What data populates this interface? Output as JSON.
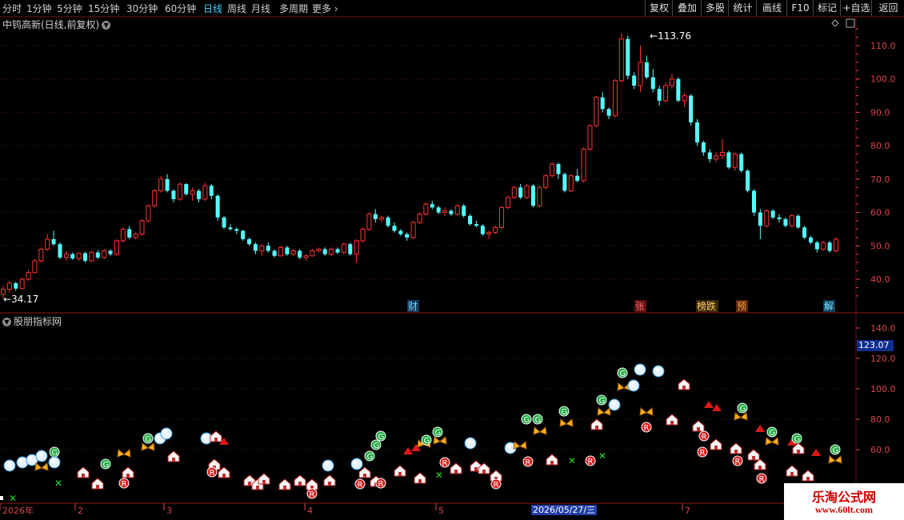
{
  "toolbar": {
    "periods": [
      "分时",
      "1分钟",
      "5分钟",
      "15分钟",
      "30分钟",
      "60分钟",
      "日线",
      "周线",
      "月线",
      "多周期",
      "更多"
    ],
    "active_period": "日线",
    "right_buttons": [
      "复权",
      "叠加",
      "多股",
      "统计",
      "画线",
      "F10",
      "标记",
      "+自选",
      "返回"
    ]
  },
  "main_panel": {
    "title": "中钨高新(日线,前复权)",
    "high_label": "113.76",
    "low_label": "34.17",
    "y_ticks": [
      "110.0",
      "100.0",
      "90.0",
      "80.0",
      "70.0",
      "60.0",
      "50.0",
      "40.0"
    ],
    "events": [
      "财",
      "张",
      "榜跌",
      "预",
      "解"
    ]
  },
  "indicator_panel": {
    "title": "股朋指标网",
    "y_ticks": [
      "140.0",
      "120.0",
      "100.0",
      "80.0",
      "60.0"
    ],
    "current_value": "123.07"
  },
  "x_axis": {
    "labels": [
      "2026年",
      "2",
      "3",
      "4",
      "5",
      "7"
    ],
    "cursor_date": "2026/05/27/三"
  },
  "watermark": {
    "line1": "乐淘公式网",
    "line2": "www.60lt.com"
  },
  "colors": {
    "up": "#ff3232",
    "down": "#54ffff",
    "grid": "#5a0f0f",
    "axis_text": "#d8454a",
    "accent": "#3fd7ff"
  },
  "chart_data": {
    "type": "candlestick",
    "price_range": [
      30,
      118
    ],
    "indicator_range": [
      55,
      150
    ],
    "ohlc": [
      [
        35.5,
        38.0,
        34.17,
        37.0
      ],
      [
        37.0,
        39.5,
        36.0,
        38.8
      ],
      [
        38.8,
        39.2,
        36.5,
        37.2
      ],
      [
        37.2,
        40.5,
        37.0,
        40.0
      ],
      [
        40.0,
        42.8,
        39.5,
        42.0
      ],
      [
        42.0,
        46.0,
        41.8,
        45.5
      ],
      [
        45.5,
        49.5,
        45.0,
        49.0
      ],
      [
        49.0,
        53.5,
        48.5,
        52.0
      ],
      [
        52.0,
        54.5,
        50.0,
        50.5
      ],
      [
        50.5,
        51.0,
        46.0,
        46.5
      ],
      [
        46.5,
        48.5,
        45.5,
        47.5
      ],
      [
        47.5,
        48.0,
        45.8,
        46.2
      ],
      [
        46.2,
        48.0,
        45.5,
        47.8
      ],
      [
        47.8,
        48.2,
        45.0,
        45.5
      ],
      [
        45.5,
        48.5,
        45.3,
        48.0
      ],
      [
        48.0,
        48.8,
        46.0,
        46.5
      ],
      [
        46.5,
        49.0,
        46.0,
        48.5
      ],
      [
        48.5,
        49.0,
        47.0,
        47.5
      ],
      [
        47.5,
        52.0,
        47.0,
        51.5
      ],
      [
        51.5,
        55.5,
        51.0,
        55.0
      ],
      [
        55.0,
        56.0,
        52.0,
        52.5
      ],
      [
        52.5,
        54.0,
        52.0,
        53.5
      ],
      [
        53.5,
        58.0,
        53.0,
        57.5
      ],
      [
        57.5,
        62.5,
        57.0,
        62.0
      ],
      [
        62.0,
        67.0,
        61.5,
        66.5
      ],
      [
        66.5,
        71.0,
        66.0,
        70.0
      ],
      [
        70.0,
        71.5,
        66.0,
        66.5
      ],
      [
        66.5,
        67.0,
        63.0,
        64.0
      ],
      [
        64.0,
        69.0,
        63.5,
        68.5
      ],
      [
        68.5,
        68.8,
        65.0,
        65.5
      ],
      [
        65.5,
        67.5,
        63.5,
        66.5
      ],
      [
        66.5,
        67.0,
        63.0,
        64.0
      ],
      [
        64.0,
        69.0,
        63.5,
        68.0
      ],
      [
        68.0,
        68.5,
        64.0,
        65.0
      ],
      [
        65.0,
        65.5,
        57.5,
        58.5
      ],
      [
        58.5,
        59.0,
        55.0,
        55.5
      ],
      [
        55.5,
        56.5,
        54.5,
        55.0
      ],
      [
        55.0,
        55.5,
        53.5,
        54.5
      ],
      [
        54.5,
        54.8,
        51.5,
        52.0
      ],
      [
        52.0,
        52.5,
        50.0,
        50.5
      ],
      [
        50.5,
        51.0,
        47.5,
        48.5
      ],
      [
        48.5,
        50.5,
        47.0,
        50.0
      ],
      [
        50.0,
        51.0,
        48.0,
        48.5
      ],
      [
        48.5,
        49.0,
        46.5,
        47.0
      ],
      [
        47.0,
        50.0,
        46.8,
        49.5
      ],
      [
        49.5,
        50.0,
        47.0,
        47.5
      ],
      [
        47.5,
        49.0,
        47.0,
        48.5
      ],
      [
        48.5,
        49.0,
        46.0,
        46.5
      ],
      [
        46.5,
        47.5,
        45.5,
        47.0
      ],
      [
        47.0,
        49.0,
        46.8,
        48.5
      ],
      [
        48.5,
        49.5,
        48.0,
        49.0
      ],
      [
        49.0,
        49.5,
        47.0,
        47.5
      ],
      [
        47.5,
        49.5,
        47.0,
        49.0
      ],
      [
        49.0,
        49.5,
        47.5,
        48.0
      ],
      [
        48.0,
        51.0,
        47.5,
        50.5
      ],
      [
        50.5,
        51.0,
        47.0,
        47.5
      ],
      [
        47.5,
        52.0,
        45.0,
        51.5
      ],
      [
        51.5,
        55.5,
        51.0,
        55.0
      ],
      [
        55.0,
        60.0,
        54.5,
        59.5
      ],
      [
        59.5,
        61.0,
        57.0,
        58.0
      ],
      [
        58.0,
        59.0,
        57.0,
        58.5
      ],
      [
        58.5,
        59.0,
        55.5,
        56.0
      ],
      [
        56.0,
        57.0,
        54.0,
        54.5
      ],
      [
        54.5,
        55.0,
        53.0,
        53.5
      ],
      [
        53.5,
        54.0,
        51.5,
        52.5
      ],
      [
        52.5,
        57.5,
        52.0,
        57.0
      ],
      [
        57.0,
        60.0,
        56.5,
        59.5
      ],
      [
        59.5,
        63.0,
        59.0,
        62.5
      ],
      [
        62.5,
        63.5,
        61.0,
        61.5
      ],
      [
        61.5,
        62.0,
        59.5,
        60.0
      ],
      [
        60.0,
        61.5,
        59.0,
        60.5
      ],
      [
        60.5,
        61.0,
        59.0,
        59.5
      ],
      [
        59.5,
        62.5,
        59.0,
        62.0
      ],
      [
        62.0,
        62.5,
        58.5,
        59.0
      ],
      [
        59.0,
        59.5,
        56.0,
        56.5
      ],
      [
        56.5,
        57.5,
        55.5,
        56.0
      ],
      [
        56.0,
        56.5,
        53.0,
        53.5
      ],
      [
        53.5,
        54.5,
        52.0,
        54.0
      ],
      [
        54.0,
        56.0,
        53.5,
        55.5
      ],
      [
        55.5,
        62.0,
        55.0,
        61.5
      ],
      [
        61.5,
        65.0,
        61.0,
        64.5
      ],
      [
        64.5,
        68.0,
        64.0,
        67.5
      ],
      [
        67.5,
        68.5,
        64.0,
        64.5
      ],
      [
        64.5,
        68.5,
        64.0,
        68.0
      ],
      [
        68.0,
        68.5,
        61.5,
        62.0
      ],
      [
        62.0,
        68.0,
        61.5,
        67.5
      ],
      [
        67.5,
        71.5,
        67.0,
        71.0
      ],
      [
        71.0,
        75.0,
        70.5,
        74.5
      ],
      [
        74.5,
        75.0,
        70.0,
        71.5
      ],
      [
        71.5,
        72.0,
        66.0,
        66.5
      ],
      [
        66.5,
        71.5,
        66.0,
        71.0
      ],
      [
        71.0,
        73.0,
        69.0,
        69.5
      ],
      [
        69.5,
        79.5,
        69.0,
        79.0
      ],
      [
        79.0,
        86.5,
        78.5,
        86.0
      ],
      [
        86.0,
        95.0,
        85.5,
        94.5
      ],
      [
        94.5,
        96.0,
        90.0,
        91.0
      ],
      [
        91.0,
        91.5,
        88.0,
        89.0
      ],
      [
        89.0,
        100.0,
        88.5,
        99.5
      ],
      [
        99.5,
        113.76,
        99.0,
        112.0
      ],
      [
        112.0,
        113.0,
        100.0,
        101.0
      ],
      [
        101.0,
        102.0,
        97.0,
        98.0
      ],
      [
        98.0,
        110.0,
        96.0,
        105.0
      ],
      [
        105.0,
        107.0,
        100.0,
        100.5
      ],
      [
        100.5,
        103.0,
        96.0,
        97.0
      ],
      [
        97.0,
        98.0,
        92.0,
        93.5
      ],
      [
        93.5,
        99.0,
        93.0,
        98.0
      ],
      [
        98.0,
        101.5,
        97.0,
        100.0
      ],
      [
        100.0,
        100.5,
        93.0,
        93.5
      ],
      [
        93.5,
        96.0,
        91.5,
        95.0
      ],
      [
        95.0,
        95.5,
        86.0,
        87.0
      ],
      [
        87.0,
        88.0,
        80.0,
        81.0
      ],
      [
        81.0,
        81.5,
        77.0,
        78.0
      ],
      [
        78.0,
        79.0,
        75.0,
        76.0
      ],
      [
        76.0,
        78.0,
        75.0,
        77.0
      ],
      [
        77.0,
        82.0,
        76.0,
        78.0
      ],
      [
        78.0,
        78.5,
        73.0,
        73.5
      ],
      [
        73.5,
        78.0,
        72.5,
        77.5
      ],
      [
        77.5,
        78.0,
        72.0,
        72.5
      ],
      [
        72.5,
        73.0,
        66.0,
        66.5
      ],
      [
        66.5,
        67.0,
        59.0,
        60.0
      ],
      [
        60.0,
        61.0,
        52.0,
        56.0
      ],
      [
        56.0,
        61.0,
        55.5,
        60.5
      ],
      [
        60.5,
        61.0,
        58.0,
        58.5
      ],
      [
        58.5,
        59.5,
        57.0,
        58.0
      ],
      [
        58.0,
        58.5,
        55.5,
        56.0
      ],
      [
        56.0,
        59.5,
        55.5,
        59.0
      ],
      [
        59.0,
        59.5,
        55.0,
        55.5
      ],
      [
        55.5,
        56.0,
        52.0,
        52.5
      ],
      [
        52.5,
        53.0,
        50.5,
        51.0
      ],
      [
        51.0,
        51.5,
        48.0,
        49.0
      ],
      [
        49.0,
        51.5,
        48.5,
        51.0
      ],
      [
        51.0,
        51.5,
        48.0,
        48.5
      ],
      [
        48.5,
        52.5,
        48.0,
        52.0
      ]
    ]
  }
}
